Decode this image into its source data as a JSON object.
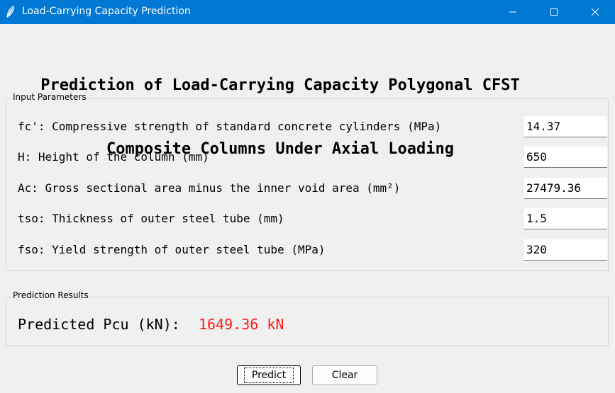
{
  "window": {
    "title": "Load-Carrying Capacity Prediction",
    "titlebar_color": "#0078d4"
  },
  "heading": {
    "line1": "Prediction of Load-Carrying Capacity Polygonal CFST",
    "line2": "Composite Columns Under Axial Loading"
  },
  "input_group": {
    "label": "Input Parameters",
    "params": [
      {
        "label": "fc': Compressive strength of standard concrete cylinders (MPa)",
        "value": "14.37"
      },
      {
        "label": "H: Height of the column (mm)",
        "value": "650"
      },
      {
        "label": "Ac: Gross sectional area minus the inner void area (mm²)",
        "value": "27479.36"
      },
      {
        "label": "tso: Thickness of outer steel tube (mm)",
        "value": "1.5"
      },
      {
        "label": "fso: Yield strength of outer steel tube (MPa)",
        "value": "320"
      }
    ]
  },
  "result_group": {
    "label": "Prediction Results",
    "result_label": "Predicted Pcu (kN):",
    "result_value": "1649.36 kN",
    "result_color": "#ff1a1a"
  },
  "buttons": {
    "predict": "Predict",
    "clear": "Clear"
  }
}
